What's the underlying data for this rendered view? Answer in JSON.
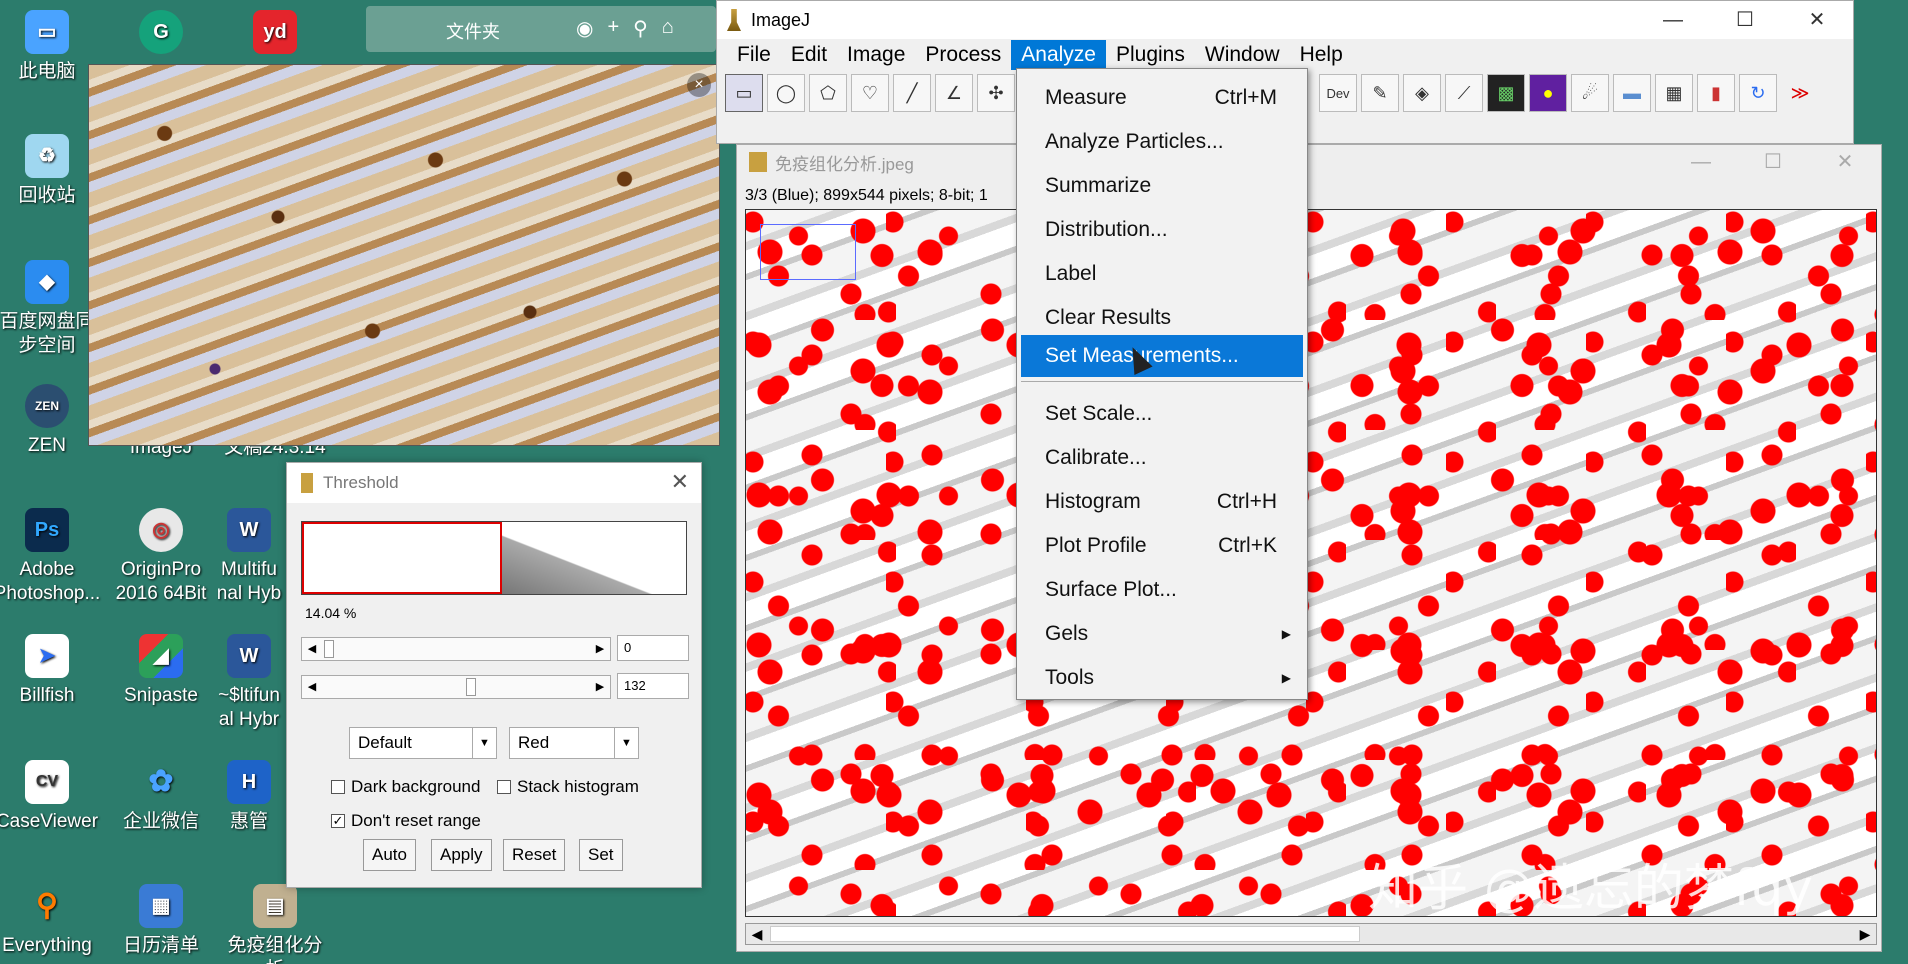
{
  "desktop": {
    "icons": [
      {
        "label": "此电脑",
        "color": "#4aa3ff"
      },
      {
        "label": "回收站",
        "color": "#9fd7f0"
      },
      {
        "label": "百度网盘同步空间",
        "color": "#2b8cf0"
      },
      {
        "label": "ZEN",
        "color": "#2b4e70"
      },
      {
        "label": "Adobe Photoshop...",
        "color": "#0b2b4d"
      },
      {
        "label": "Billfish",
        "color": "#ffffff"
      },
      {
        "label": "CaseViewer",
        "color": "#ffffff"
      },
      {
        "label": "Everything",
        "color": "#ff7b00"
      },
      {
        "label": "ImageJ",
        "color": "#c8a040"
      },
      {
        "label": "OriginPro 2016 64Bit",
        "color": "#e8e8e8"
      },
      {
        "label": "Snipaste",
        "color": "#2ca05a"
      },
      {
        "label": "企业微信",
        "color": "#4aa3ff"
      },
      {
        "label": "日历清单",
        "color": "#3a7bd5"
      },
      {
        "label": "文稿24.3.14",
        "color": "#ffffff"
      },
      {
        "label": "Multifu nal Hyb",
        "color": "#2b579a"
      },
      {
        "label": "~$ltifun al Hybr",
        "color": "#2b579a"
      },
      {
        "label": "惠管",
        "color": "#1e63c8"
      },
      {
        "label": "免疫组化分析",
        "color": "#c0b090"
      },
      {
        "label": "G",
        "color": "#15a27b"
      },
      {
        "label": "yd",
        "color": "#e4252c"
      }
    ]
  },
  "folder": {
    "label": "文件夹"
  },
  "imagej": {
    "title": "ImageJ",
    "menus": [
      "File",
      "Edit",
      "Image",
      "Process",
      "Analyze",
      "Plugins",
      "Window",
      "Help"
    ],
    "active_menu": "Analyze",
    "tools": [
      "rectangle-tool",
      "oval-tool",
      "polygon-tool",
      "freehand-tool",
      "line-tool",
      "angle-tool",
      "point-tool",
      "dev-tool",
      "brush-tool",
      "fill-tool",
      "dropper-tool",
      "lut-tool",
      "color-tool",
      "spray-tool",
      "folder-tool",
      "table-tool",
      "histogram-tool",
      "refresh-tool",
      "more-tool"
    ],
    "dev_label": "Dev",
    "more_label": "≫"
  },
  "analyze_menu": {
    "items": [
      {
        "label": "Measure",
        "shortcut": "Ctrl+M"
      },
      {
        "label": "Analyze Particles...",
        "shortcut": ""
      },
      {
        "label": "Summarize",
        "shortcut": ""
      },
      {
        "label": "Distribution...",
        "shortcut": ""
      },
      {
        "label": "Label",
        "shortcut": ""
      },
      {
        "label": "Clear Results",
        "shortcut": ""
      },
      {
        "label": "Set Measurements...",
        "shortcut": ""
      },
      {
        "label": "Set Scale...",
        "shortcut": ""
      },
      {
        "label": "Calibrate...",
        "shortcut": ""
      },
      {
        "label": "Histogram",
        "shortcut": "Ctrl+H"
      },
      {
        "label": "Plot Profile",
        "shortcut": "Ctrl+K"
      },
      {
        "label": "Surface Plot...",
        "shortcut": ""
      },
      {
        "label": "Gels",
        "shortcut": ""
      },
      {
        "label": "Tools",
        "shortcut": ""
      }
    ],
    "highlighted": "Set Measurements..."
  },
  "image_window": {
    "title": "免疫组化分析.jpeg",
    "info": "3/3 (Blue); 899x544 pixels; 8-bit; 1"
  },
  "threshold": {
    "title": "Threshold",
    "percent": "14.04 %",
    "min_value": "0",
    "max_value": "132",
    "method": "Default",
    "display": "Red",
    "dark_background": {
      "label": "Dark background",
      "checked": false
    },
    "stack_histogram": {
      "label": "Stack histogram",
      "checked": false
    },
    "dont_reset": {
      "label": "Don't reset range",
      "checked": true
    },
    "buttons": {
      "auto": "Auto",
      "apply": "Apply",
      "reset": "Reset",
      "set": "Set"
    }
  },
  "watermark": "知乎 @遗忘的梦fqy",
  "colors": {
    "desktop_bg": "#2c7c6c",
    "menu_highlight": "#0a78d8",
    "threshold_red": "#ff0000"
  }
}
